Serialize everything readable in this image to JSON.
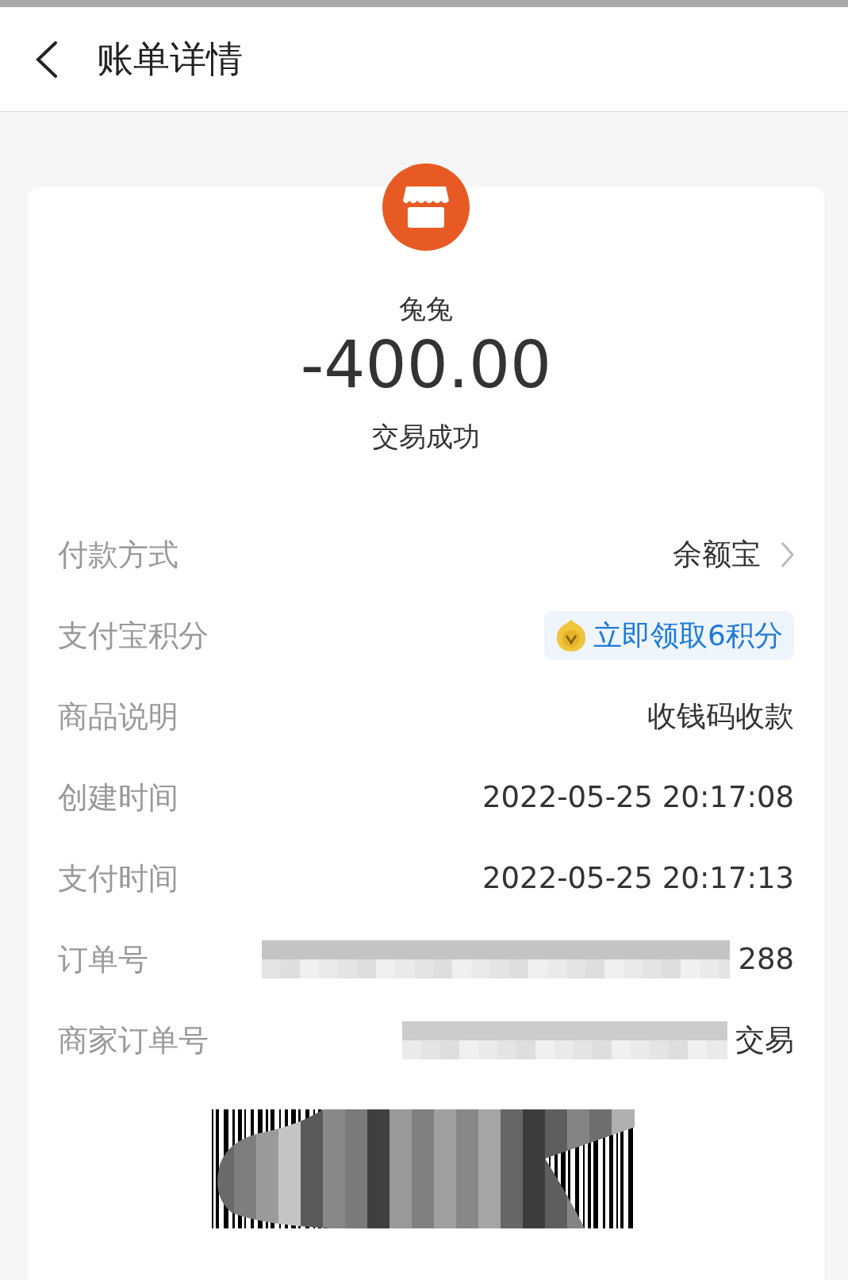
{
  "header": {
    "title": "账单详情"
  },
  "merchant": {
    "name": "兔兔"
  },
  "amount": "-400.00",
  "status": "交易成功",
  "details": [
    {
      "kind": "link",
      "label": "付款方式",
      "value": "余额宝"
    },
    {
      "kind": "reward",
      "label": "支付宝积分",
      "value": "立即领取6积分"
    },
    {
      "kind": "text",
      "label": "商品说明",
      "value": "收钱码收款"
    },
    {
      "kind": "text",
      "label": "创建时间",
      "value": "2022-05-25 20:17:08"
    },
    {
      "kind": "text",
      "label": "支付时间",
      "value": "2022-05-25 20:17:13"
    },
    {
      "kind": "masked",
      "label": "订单号",
      "value": "288"
    },
    {
      "kind": "masked",
      "label": "商家订单号",
      "value": "交易"
    }
  ],
  "barcode": {
    "masked": true
  }
}
